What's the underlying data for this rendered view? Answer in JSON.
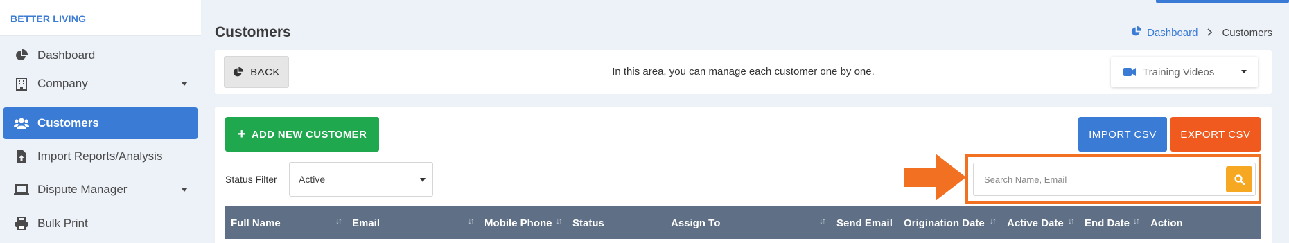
{
  "brand": {
    "name": "BETTER LIVING"
  },
  "sidebar": {
    "items": [
      {
        "label": "Dashboard",
        "icon": "pie-chart-icon",
        "active": false,
        "has_dropdown": false
      },
      {
        "label": "Company",
        "icon": "building-icon",
        "active": false,
        "has_dropdown": true
      },
      {
        "label": "Customers",
        "icon": "users-icon",
        "active": true,
        "has_dropdown": false
      },
      {
        "label": "Import Reports/Analysis",
        "icon": "file-upload-icon",
        "active": false,
        "has_dropdown": false
      },
      {
        "label": "Dispute Manager",
        "icon": "laptop-icon",
        "active": false,
        "has_dropdown": true
      },
      {
        "label": "Bulk Print",
        "icon": "printer-icon",
        "active": false,
        "has_dropdown": false
      }
    ]
  },
  "page": {
    "title": "Customers"
  },
  "breadcrumb": {
    "home": "Dashboard",
    "current": "Customers"
  },
  "info_bar": {
    "back_label": "BACK",
    "message": "In this area, you can manage each customer one by one.",
    "training_label": "Training Videos"
  },
  "actions": {
    "add_label": "ADD NEW CUSTOMER",
    "import_label": "IMPORT CSV",
    "export_label": "EXPORT CSV"
  },
  "filter": {
    "label": "Status Filter",
    "selected": "Active"
  },
  "search": {
    "placeholder": "Search Name, Email",
    "value": ""
  },
  "table": {
    "columns": [
      {
        "label": "Full Name",
        "sortable": true
      },
      {
        "label": "Email",
        "sortable": true
      },
      {
        "label": "Mobile Phone",
        "sortable": true
      },
      {
        "label": "Status",
        "sortable": false
      },
      {
        "label": "Assign To",
        "sortable": true
      },
      {
        "label": "Send Email",
        "sortable": false
      },
      {
        "label": "Origination Date",
        "sortable": true
      },
      {
        "label": "Active Date",
        "sortable": true
      },
      {
        "label": "End Date",
        "sortable": true
      },
      {
        "label": "Action",
        "sortable": false
      }
    ]
  },
  "colors": {
    "primary": "#3a7bd5",
    "success": "#1fa84d",
    "danger": "#f05a1e",
    "warning": "#f7a823",
    "highlight": "#f27021",
    "table_header": "#5f6f86"
  }
}
